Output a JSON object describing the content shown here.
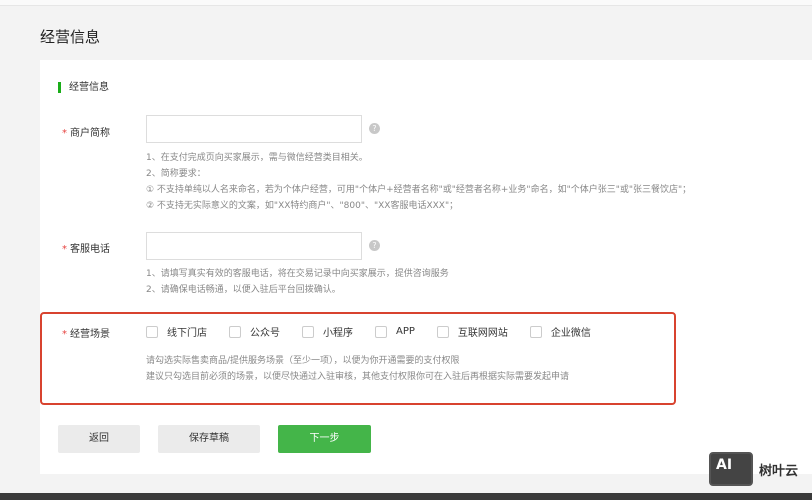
{
  "page_title": "经营信息",
  "section_title": "经营信息",
  "fields": {
    "short_name": {
      "label": "商户简称",
      "value": "",
      "tips": [
        "1、在支付完成页向买家展示，需与微信经营类目相关。",
        "2、简称要求：",
        "① 不支持单纯以人名来命名，若为个体户经营，可用\"个体户+经营者名称\"或\"经营者名称+业务\"命名，如\"个体户张三\"或\"张三餐饮店\"；",
        "② 不支持无实际意义的文案，如\"XX特约商户\"、\"800\"、\"XX客服电话XXX\"；"
      ]
    },
    "phone": {
      "label": "客服电话",
      "value": "",
      "tips": [
        "1、请填写真实有效的客服电话，将在交易记录中向买家展示，提供咨询服务",
        "2、请确保电话畅通，以便入驻后平台回拨确认。"
      ]
    },
    "scenes": {
      "label": "经营场景",
      "options": [
        "线下门店",
        "公众号",
        "小程序",
        "APP",
        "互联网网站",
        "企业微信"
      ],
      "tips": [
        "请勾选实际售卖商品/提供服务场景（至少一项），以便为你开通需要的支付权限",
        "建议只勾选目前必须的场景，以便尽快通过入驻审核，其他支付权限你可在入驻后再根据实际需要发起申请"
      ]
    }
  },
  "help_glyph": "?",
  "required_mark": "*",
  "buttons": {
    "back": "返回",
    "save": "保存草稿",
    "next": "下一步"
  },
  "watermark": {
    "logo": "AI",
    "text": "树叶云"
  },
  "colors": {
    "accent": "#44b549",
    "highlight": "#d8432f"
  }
}
